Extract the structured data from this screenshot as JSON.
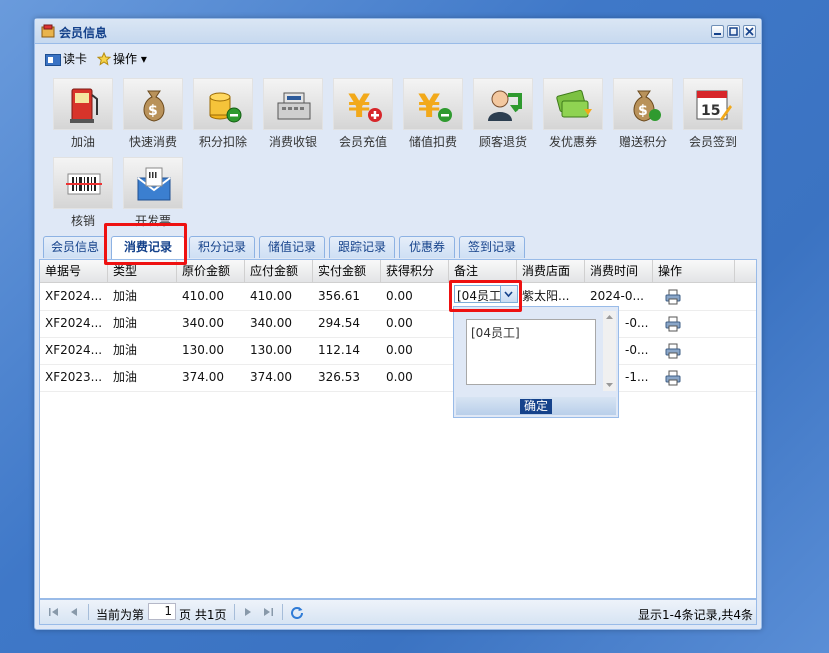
{
  "window": {
    "title": "会员信息"
  },
  "toolbar": {
    "read_card": "读卡",
    "operation": "操作 ▾"
  },
  "tiles": [
    {
      "label": "加油",
      "icon": "fuel-pump-icon"
    },
    {
      "label": "快速消费",
      "icon": "money-bag-icon"
    },
    {
      "label": "积分扣除",
      "icon": "coins-minus-icon"
    },
    {
      "label": "消费收银",
      "icon": "cash-register-icon"
    },
    {
      "label": "会员充值",
      "icon": "yuan-plus-icon"
    },
    {
      "label": "储值扣费",
      "icon": "yuan-minus-icon"
    },
    {
      "label": "顾客退货",
      "icon": "customer-return-icon"
    },
    {
      "label": "发优惠券",
      "icon": "coupon-icon"
    },
    {
      "label": "赠送积分",
      "icon": "money-bag-gift-icon"
    },
    {
      "label": "会员签到",
      "icon": "calendar-checkin-icon"
    },
    {
      "label": "核销",
      "icon": "barcode-scanner-icon"
    },
    {
      "label": "开发票",
      "icon": "invoice-envelope-icon"
    }
  ],
  "tabs": [
    "会员信息",
    "消费记录",
    "积分记录",
    "储值记录",
    "跟踪记录",
    "优惠券",
    "签到记录"
  ],
  "active_tab": "消费记录",
  "grid": {
    "columns": [
      "单据号",
      "类型",
      "原价金额",
      "应付金额",
      "实付金额",
      "获得积分",
      "备注",
      "消费店面",
      "消费时间",
      "操作"
    ],
    "rows": [
      {
        "id": "XF2024...",
        "type": "加油",
        "orig": "410.00",
        "due": "410.00",
        "paid": "356.61",
        "points": "0.00",
        "store": "紫太阳...",
        "time": "2024-0..."
      },
      {
        "id": "XF2024...",
        "type": "加油",
        "orig": "340.00",
        "due": "340.00",
        "paid": "294.54",
        "points": "0.00",
        "store": "",
        "time": "-0..."
      },
      {
        "id": "XF2024...",
        "type": "加油",
        "orig": "130.00",
        "due": "130.00",
        "paid": "112.14",
        "points": "0.00",
        "store": "",
        "time": "-0..."
      },
      {
        "id": "XF2023...",
        "type": "加油",
        "orig": "374.00",
        "due": "374.00",
        "paid": "326.53",
        "points": "0.00",
        "store": "",
        "time": "-1..."
      }
    ]
  },
  "remark_editor": {
    "combo_value": "[04员工",
    "textarea_value": "[04员工]",
    "ok_label": "确定"
  },
  "pager": {
    "prefix": "当前为第",
    "page": "1",
    "suffix": "页 共1页",
    "summary": "显示1-4条记录,共4条"
  },
  "colors": {
    "header_text": "#15428b",
    "highlight": "#e11111",
    "border": "#99bbe8"
  }
}
